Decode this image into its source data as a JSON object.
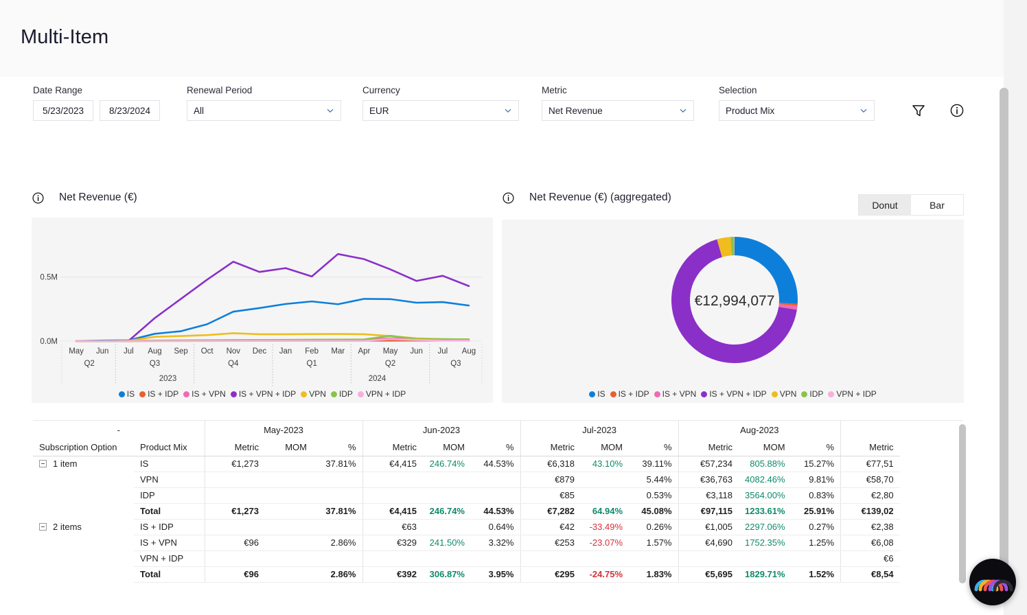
{
  "page": {
    "title": "Multi-Item"
  },
  "filters": {
    "date_range": {
      "label": "Date Range",
      "start": "5/23/2023",
      "end": "8/23/2024"
    },
    "renewal_period": {
      "label": "Renewal Period",
      "value": "All"
    },
    "currency": {
      "label": "Currency",
      "value": "EUR"
    },
    "metric": {
      "label": "Metric",
      "value": "Net Revenue"
    },
    "selection": {
      "label": "Selection",
      "value": "Product Mix"
    },
    "filter_icon": "filter-icon",
    "info_icon": "info-icon"
  },
  "series_colors": {
    "IS": "#0d7fdb",
    "IS + IDP": "#e8602c",
    "IS + VPN": "#f06ab4",
    "IS + VPN + IDP": "#8b2fc9",
    "VPN": "#f0bc1e",
    "IDP": "#8bc34a",
    "VPN + IDP": "#f9aede"
  },
  "line_panel": {
    "title": "Net Revenue (€)",
    "info_icon": "info-icon"
  },
  "donut_panel": {
    "title": "Net Revenue (€) (aggregated)",
    "info_icon": "info-icon",
    "toggle": {
      "donut": "Donut",
      "bar": "Bar",
      "active": "Donut"
    },
    "center_value": "€12,994,077"
  },
  "chart_data": [
    {
      "type": "line",
      "title": "Net Revenue (€)",
      "xlabel": "",
      "ylabel": "",
      "ylim": [
        0,
        900000
      ],
      "ytick_labels": [
        "0.0M",
        "0.5M"
      ],
      "ytick_values": [
        0,
        500000
      ],
      "grid": true,
      "legend": "bottom",
      "x": [
        "May",
        "Jun",
        "Jul",
        "Aug",
        "Sep",
        "Oct",
        "Nov",
        "Dec",
        "Jan",
        "Feb",
        "Mar",
        "Apr",
        "May",
        "Jun",
        "Jul",
        "Aug"
      ],
      "x_quarters": [
        {
          "label": "Q2",
          "months": [
            "May",
            "Jun"
          ]
        },
        {
          "label": "Q3",
          "months": [
            "Jul",
            "Aug",
            "Sep"
          ]
        },
        {
          "label": "Q4",
          "months": [
            "Oct",
            "Nov",
            "Dec"
          ]
        },
        {
          "label": "Q1",
          "months": [
            "Jan",
            "Feb",
            "Mar"
          ]
        },
        {
          "label": "Q2",
          "months": [
            "Apr",
            "May",
            "Jun"
          ]
        },
        {
          "label": "Q3",
          "months": [
            "Jul",
            "Aug"
          ]
        }
      ],
      "x_years": [
        "2023",
        "2024"
      ],
      "series": [
        {
          "name": "IS",
          "color": "#0d7fdb",
          "values": [
            1273,
            4415,
            6318,
            57234,
            77515,
            132000,
            230000,
            258000,
            290000,
            310000,
            288000,
            330000,
            328000,
            300000,
            305000,
            278000
          ]
        },
        {
          "name": "IS + IDP",
          "color": "#e8602c",
          "values": [
            0,
            63,
            42,
            1005,
            2380,
            3000,
            3200,
            3400,
            3500,
            3600,
            3700,
            3800,
            3900,
            4000,
            4100,
            4200
          ]
        },
        {
          "name": "IS + VPN",
          "color": "#f06ab4",
          "values": [
            96,
            329,
            253,
            4690,
            6080,
            7000,
            7500,
            8000,
            8500,
            9000,
            9500,
            10000,
            22000,
            20000,
            12000,
            11000
          ]
        },
        {
          "name": "IS + VPN + IDP",
          "color": "#8b2fc9",
          "values": [
            0,
            0,
            2000,
            180000,
            330000,
            480000,
            620000,
            540000,
            570000,
            505000,
            680000,
            640000,
            560000,
            470000,
            510000,
            430000
          ]
        },
        {
          "name": "VPN",
          "color": "#f0bc1e",
          "values": [
            0,
            0,
            3000,
            34000,
            40000,
            47000,
            62000,
            54000,
            54000,
            55000,
            56000,
            54000,
            40000,
            22000,
            16000,
            14000
          ]
        },
        {
          "name": "IDP",
          "color": "#8bc34a",
          "values": [
            0,
            0,
            85,
            3118,
            2800,
            6000,
            8000,
            9000,
            10000,
            11000,
            12000,
            13000,
            42000,
            16000,
            15000,
            14000
          ]
        },
        {
          "name": "VPN + IDP",
          "color": "#f9aede",
          "values": [
            0,
            0,
            0,
            0,
            600,
            1200,
            1500,
            1600,
            1700,
            1800,
            1900,
            2000,
            16000,
            9000,
            4000,
            3500
          ]
        }
      ]
    },
    {
      "type": "pie",
      "title": "Net Revenue (€) (aggregated)",
      "center_label": "€12,994,077",
      "total": 12994077,
      "legend": "bottom",
      "labels": [
        "IS",
        "IS + IDP",
        "IS + VPN",
        "IS + VPN + IDP",
        "VPN",
        "IDP",
        "VPN + IDP"
      ],
      "colors": [
        "#0d7fdb",
        "#e8602c",
        "#f06ab4",
        "#8b2fc9",
        "#f0bc1e",
        "#8bc34a",
        "#f9aede"
      ],
      "values": [
        3378460,
        64970,
        129940,
        8836000,
        454792,
        116946,
        12994
      ],
      "percentages": [
        26.0,
        0.5,
        1.0,
        68.0,
        3.5,
        0.9,
        0.1
      ]
    }
  ],
  "table": {
    "group_headers": [
      {
        "label": "-",
        "span": 2
      },
      {
        "label": "May-2023",
        "span": 3
      },
      {
        "label": "Jun-2023",
        "span": 3
      },
      {
        "label": "Jul-2023",
        "span": 3
      },
      {
        "label": "Aug-2023",
        "span": 3
      },
      {
        "label": "",
        "span": 1
      }
    ],
    "sub_headers": [
      "Subscription Option",
      "Product Mix",
      "Metric",
      "MOM",
      "%",
      "Metric",
      "MOM",
      "%",
      "Metric",
      "MOM",
      "%",
      "Metric",
      "MOM",
      "%",
      "Metric"
    ],
    "rows": [
      {
        "group": "1 item",
        "first_of_group": true,
        "mix": "IS",
        "total": false,
        "cells": [
          "€1,273",
          "",
          "37.81%",
          "€4,415",
          "246.74%",
          "44.53%",
          "€6,318",
          "43.10%",
          "39.11%",
          "€57,234",
          "805.88%",
          "15.27%",
          "€77,51"
        ],
        "mom_sign": [
          "",
          "pos",
          "pos",
          "pos"
        ]
      },
      {
        "group": "",
        "first_of_group": false,
        "mix": "VPN",
        "total": false,
        "cells": [
          "",
          "",
          "",
          "",
          "",
          "",
          "€879",
          "",
          "5.44%",
          "€36,763",
          "4082.46%",
          "9.81%",
          "€58,70"
        ],
        "mom_sign": [
          "",
          "",
          "",
          "pos"
        ]
      },
      {
        "group": "",
        "first_of_group": false,
        "mix": "IDP",
        "total": false,
        "cells": [
          "",
          "",
          "",
          "",
          "",
          "",
          "€85",
          "",
          "0.53%",
          "€3,118",
          "3564.00%",
          "0.83%",
          "€2,80"
        ],
        "mom_sign": [
          "",
          "",
          "",
          "pos"
        ]
      },
      {
        "group": "",
        "first_of_group": false,
        "mix": "Total",
        "total": true,
        "cells": [
          "€1,273",
          "",
          "37.81%",
          "€4,415",
          "246.74%",
          "44.53%",
          "€7,282",
          "64.94%",
          "45.08%",
          "€97,115",
          "1233.61%",
          "25.91%",
          "€139,02"
        ],
        "mom_sign": [
          "",
          "pos",
          "pos",
          "pos"
        ]
      },
      {
        "group": "2 items",
        "first_of_group": true,
        "mix": "IS + IDP",
        "total": false,
        "cells": [
          "",
          "",
          "",
          "€63",
          "",
          "0.64%",
          "€42",
          "-33.49%",
          "0.26%",
          "€1,005",
          "2297.06%",
          "0.27%",
          "€2,38"
        ],
        "mom_sign": [
          "",
          "",
          "neg",
          "pos"
        ]
      },
      {
        "group": "",
        "first_of_group": false,
        "mix": "IS + VPN",
        "total": false,
        "cells": [
          "€96",
          "",
          "2.86%",
          "€329",
          "241.50%",
          "3.32%",
          "€253",
          "-23.07%",
          "1.57%",
          "€4,690",
          "1752.35%",
          "1.25%",
          "€6,08"
        ],
        "mom_sign": [
          "",
          "pos",
          "neg",
          "pos"
        ]
      },
      {
        "group": "",
        "first_of_group": false,
        "mix": "VPN + IDP",
        "total": false,
        "cells": [
          "",
          "",
          "",
          "",
          "",
          "",
          "",
          "",
          "",
          "",
          "",
          "",
          "€6"
        ],
        "mom_sign": [
          "",
          "",
          "",
          ""
        ]
      },
      {
        "group": "",
        "first_of_group": false,
        "mix": "Total",
        "total": true,
        "cells": [
          "€96",
          "",
          "2.86%",
          "€392",
          "306.87%",
          "3.95%",
          "€295",
          "-24.75%",
          "1.83%",
          "€5,695",
          "1829.71%",
          "1.52%",
          "€8,54"
        ],
        "mom_sign": [
          "",
          "pos",
          "neg",
          "pos"
        ]
      }
    ]
  }
}
